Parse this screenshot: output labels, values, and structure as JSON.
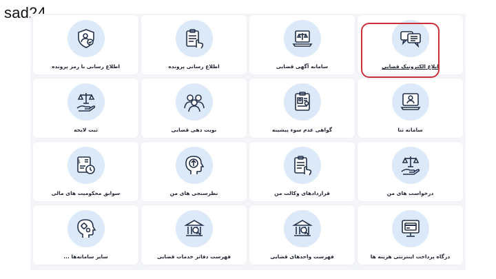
{
  "watermark": "sad24",
  "accent_color": "#c9303a",
  "tiles": [
    {
      "label": "ابلاغ الکترونیک قضایی",
      "icon": "message-bubbles-icon",
      "highlighted": true
    },
    {
      "label": "سامانه آگهی قضایی",
      "icon": "laptop-scales-icon"
    },
    {
      "label": "اطلاع رسانی پرونده",
      "icon": "clipboard-hand-icon"
    },
    {
      "label": "اطلاع رسانی با رمز پرونده",
      "icon": "shield-user-icon"
    },
    {
      "label": "سامانه ثنا",
      "icon": "monitor-user-icon"
    },
    {
      "label": "گواهی عدم سوء پیشینه",
      "icon": "certificate-icon"
    },
    {
      "label": "نوبت دهی قضایی",
      "icon": "people-group-icon"
    },
    {
      "label": "ثبت لایحه",
      "icon": "hand-scales-icon"
    },
    {
      "label": "درخواست های من",
      "icon": "hand-scales-icon"
    },
    {
      "label": "قراردادهای وکالت من",
      "icon": "clipboard-hand-icon"
    },
    {
      "label": "نظرسنجی های من",
      "icon": "head-arrow-icon"
    },
    {
      "label": "سوابق محکومیت های مالی",
      "icon": "money-clock-icon"
    },
    {
      "label": "درگاه پرداخت اینترنتی هزینه ها",
      "icon": "monitor-card-icon"
    },
    {
      "label": "فهرست واحدهای قضایی",
      "icon": "building-search-icon"
    },
    {
      "label": "فهرست دفاتر خدمات قضایی",
      "icon": "building-search-icon"
    },
    {
      "label": "سایر سامانه‌ها ...",
      "icon": "head-gears-icon"
    }
  ]
}
